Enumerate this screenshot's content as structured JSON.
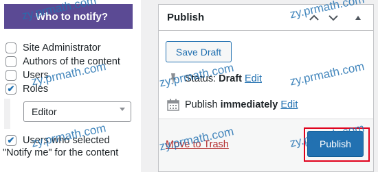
{
  "notify_panel": {
    "title": "Who to notify?",
    "options": [
      {
        "label": "Site Administrator",
        "checked": false
      },
      {
        "label": "Authors of the content",
        "checked": false
      },
      {
        "label": "Users",
        "checked": false
      },
      {
        "label": "Roles",
        "checked": true
      }
    ],
    "role_select": {
      "value": "Editor"
    },
    "users_selected": {
      "line1": "Users who selected",
      "line2": "\"Notify me\" for the content",
      "checked": true
    }
  },
  "publish_box": {
    "title": "Publish",
    "save_draft_label": "Save Draft",
    "status": {
      "prefix": "Status:",
      "value": "Draft",
      "edit_label": "Edit"
    },
    "schedule": {
      "prefix": "Publish",
      "value": "immediately",
      "edit_label": "Edit"
    },
    "trash_label": "Move to Trash",
    "publish_label": "Publish",
    "icons": {
      "up": "chevron-up-icon",
      "down": "chevron-down-icon",
      "toggle": "triangle-up-icon",
      "status": "pin-icon",
      "schedule": "calendar-icon"
    }
  },
  "watermark": "zy.prmath.com",
  "colors": {
    "header_purple": "#5b4a94",
    "link_blue": "#2271b1",
    "trash_red": "#b32d2e",
    "highlight_red": "#e0001b"
  }
}
